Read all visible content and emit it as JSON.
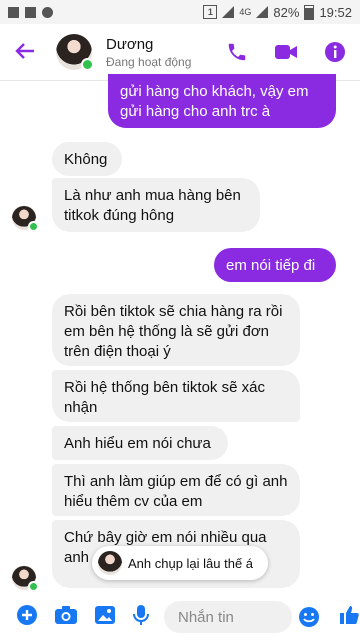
{
  "status_bar": {
    "battery": "82%",
    "time": "19:52",
    "network": "4G"
  },
  "header": {
    "contact_name": "Dương",
    "contact_status": "Đang hoạt động"
  },
  "messages": [
    {
      "side": "out",
      "text": "gửi hàng cho khách, vậy em gửi hàng cho anh trc à"
    },
    {
      "side": "in",
      "text": "Không"
    },
    {
      "side": "in",
      "text": "Là như anh mua hàng bên titkok đúng hông"
    },
    {
      "side": "out",
      "text": "em nói tiếp đi"
    },
    {
      "side": "in",
      "text": "Rồi bên tiktok sẽ chia hàng ra rồi em bên hệ thống là sẽ gửi đơn trên điện thoại ý"
    },
    {
      "side": "in",
      "text": "Rồi hệ thống bên tiktok sẽ xác nhận"
    },
    {
      "side": "in",
      "text": "Anh hiểu em nói chưa"
    },
    {
      "side": "in",
      "text": "Thì anh làm giúp em để có gì anh hiểu thêm cv của em"
    },
    {
      "side": "in",
      "text": "Chứ bây giờ em nói nhiều qua anh ... m đâu"
    }
  ],
  "typing_preview": "Anh chụp lại lâu thế á",
  "composer": {
    "placeholder": "Nhắn tin"
  },
  "colors": {
    "accent": "#8a2be2",
    "composer_icons": "#1877f2",
    "online": "#31c24d"
  }
}
